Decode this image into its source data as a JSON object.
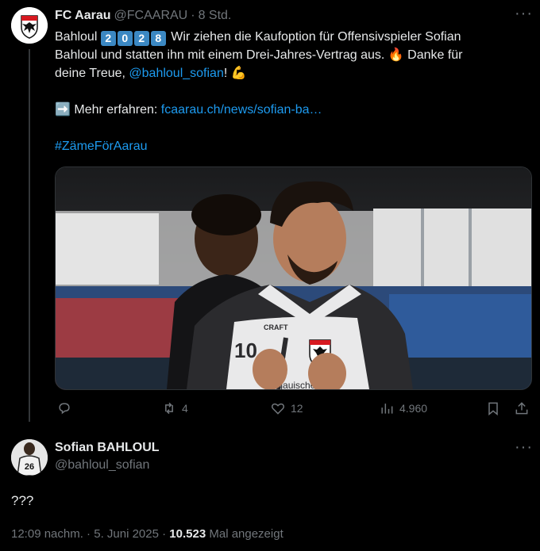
{
  "tweet": {
    "author_name": "FC Aarau",
    "handle": "@FCAARAU",
    "separator": "·",
    "time": "8 Std.",
    "text_line1_pre": "Bahloul ",
    "year_digits": [
      "2",
      "0",
      "2",
      "8"
    ],
    "text_line1_post": " Wir ziehen die Kaufoption für Offensivspieler Sofian",
    "text_line2": "Bahloul und statten ihn mit einem Drei-Jahres-Vertrag aus. 🔥 Danke für",
    "text_line3_pre": "deine Treue, ",
    "mention": "@bahloul_sofian",
    "text_line3_post": "! 💪",
    "more_prefix": "➡️ Mehr erfahren: ",
    "more_link": "fcaarau.ch/news/sofian-ba…",
    "hashtag": "#ZämeFörAarau",
    "replies": "",
    "retweets": "4",
    "likes": "12",
    "views": "4.960"
  },
  "reply": {
    "author_name": "Sofian BAHLOUL",
    "handle": "@bahloul_sofian",
    "text": "???",
    "avatar_number": "26",
    "timestamp": "12:09 nachm. · 5. Juni 2025 · ",
    "view_count": "10.523",
    "view_label": " Mal angezeigt"
  },
  "media_lettering": {
    "shirt_number": "10",
    "sponsor": "CRAFT",
    "shirt_text": "aargauische"
  },
  "colors": {
    "link": "#1d9bf0",
    "muted": "#71767b",
    "text": "#e7e9ea",
    "background": "#000000",
    "club_red": "#d71920"
  },
  "icons": [
    "more-icon",
    "reply-icon",
    "retweet-icon",
    "like-icon",
    "views-icon",
    "bookmark-icon",
    "share-icon"
  ]
}
